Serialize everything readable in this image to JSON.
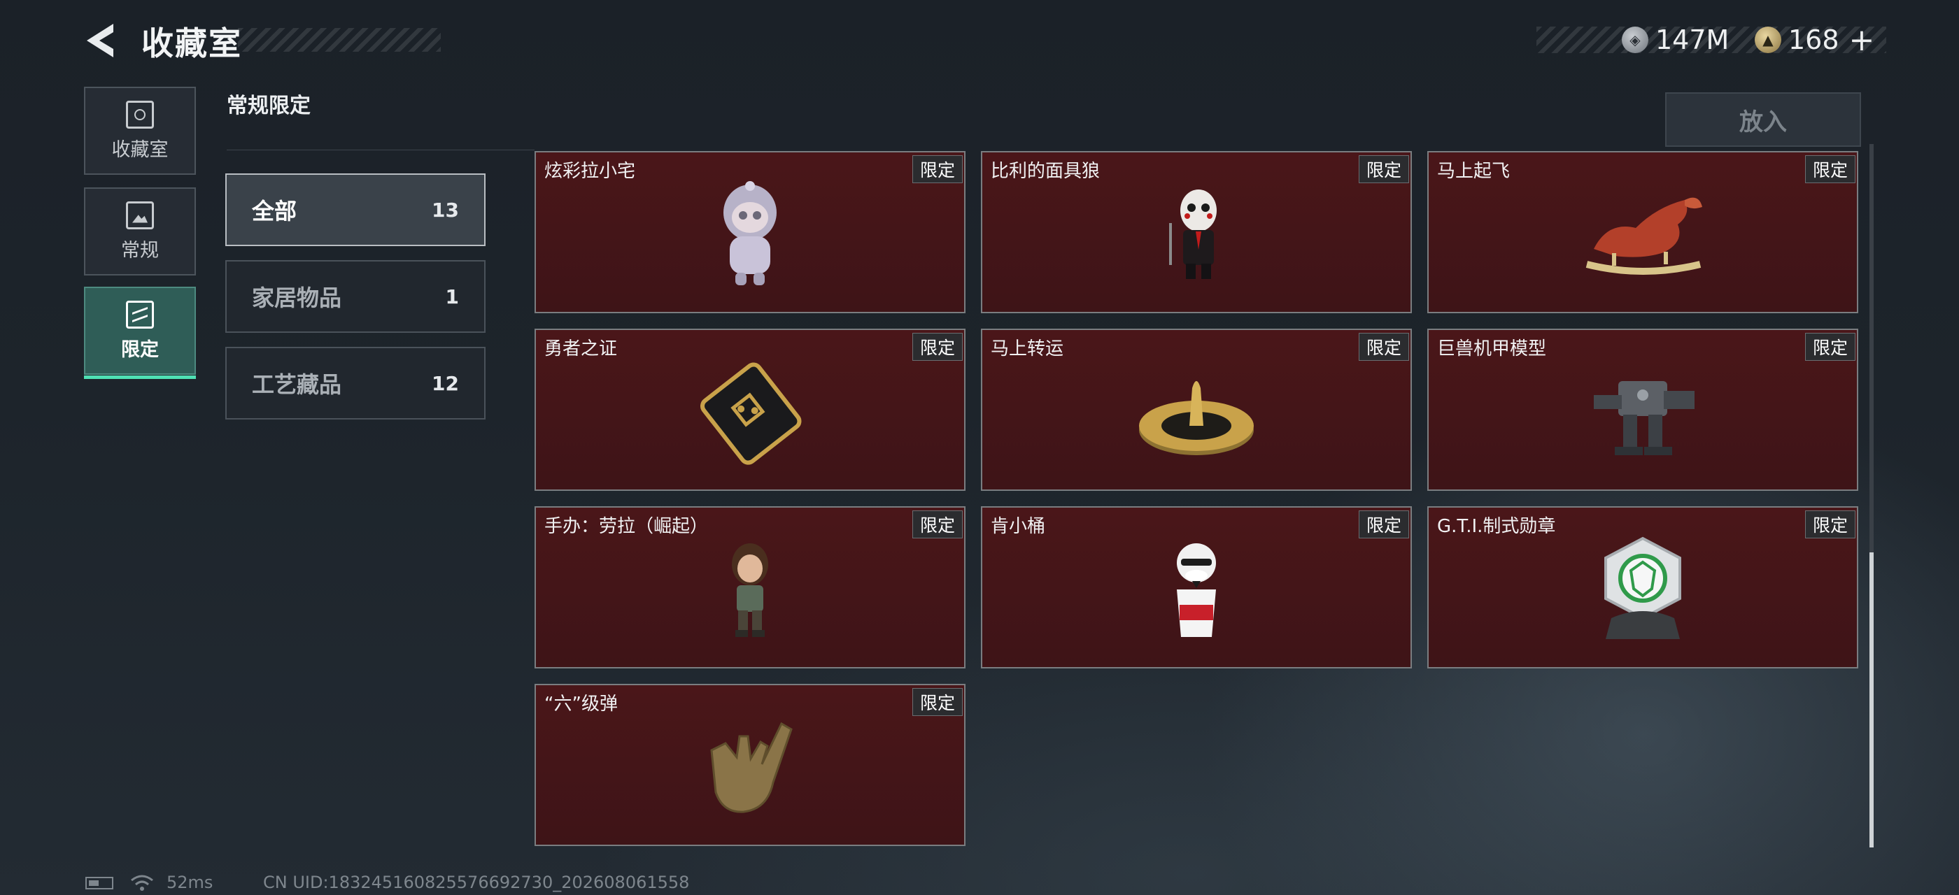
{
  "header": {
    "title": "收藏室",
    "currencies": [
      {
        "icon": "silver-coin-icon",
        "value": "147M"
      },
      {
        "icon": "gold-coin-icon",
        "value": "168"
      }
    ],
    "add_label": "+"
  },
  "side_tabs": [
    {
      "label": "收藏室",
      "icon": "collection-room-icon",
      "active": false
    },
    {
      "label": "常规",
      "icon": "regular-icon",
      "active": false
    },
    {
      "label": "限定",
      "icon": "limited-icon",
      "active": true
    }
  ],
  "section_title": "常规限定",
  "categories": [
    {
      "name": "全部",
      "count": "13",
      "active": true
    },
    {
      "name": "家居物品",
      "count": "1",
      "active": false
    },
    {
      "name": "工艺藏品",
      "count": "12",
      "active": false
    }
  ],
  "place_button": "放入",
  "items": [
    {
      "name": "炫彩拉小宅",
      "badge": "限定",
      "icon": "hooded-doll-figurine-icon"
    },
    {
      "name": "比利的面具狼",
      "badge": "限定",
      "icon": "puppet-figurine-icon"
    },
    {
      "name": "马上起飞",
      "badge": "限定",
      "icon": "rocking-horse-icon"
    },
    {
      "name": "勇者之证",
      "badge": "限定",
      "icon": "card-plaque-icon"
    },
    {
      "name": "马上转运",
      "badge": "限定",
      "icon": "golden-spinner-icon"
    },
    {
      "name": "巨兽机甲模型",
      "badge": "限定",
      "icon": "mech-model-icon"
    },
    {
      "name": "手办：劳拉（崛起）",
      "badge": "限定",
      "icon": "lara-figurine-icon"
    },
    {
      "name": "肯小桶",
      "badge": "限定",
      "icon": "colonel-figurine-icon"
    },
    {
      "name": "G.T.I.制式勋章",
      "badge": "限定",
      "icon": "gti-medal-icon"
    },
    {
      "name": "“六”级弹",
      "badge": "限定",
      "icon": "hand-sign-statue-icon"
    }
  ],
  "status": {
    "ping": "52ms",
    "uid": "CN UID:18324516082557669273‌0_202608061558"
  },
  "colors": {
    "accent": "#4fe0b4",
    "card_bg": "#4a1619",
    "active_tab": "#2f5d57"
  }
}
